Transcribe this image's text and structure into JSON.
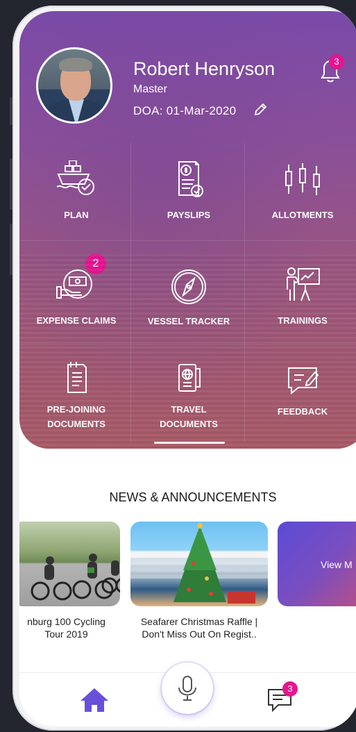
{
  "profile": {
    "name": "Robert Henryson",
    "rank": "Master",
    "doa": "DOA:  01-Mar-2020",
    "notification_count": "3"
  },
  "menu": [
    {
      "label_1": "PLAN",
      "label_2": "",
      "icon": "ship-check-icon"
    },
    {
      "label_1": "PAYSLIPS",
      "label_2": "",
      "icon": "payslip-icon"
    },
    {
      "label_1": "ALLOTMENTS",
      "label_2": "",
      "icon": "candlestick-icon"
    },
    {
      "label_1": "EXPENSE CLAIMS",
      "label_2": "",
      "icon": "expense-icon",
      "badge": "2"
    },
    {
      "label_1": "VESSEL TRACKER",
      "label_2": "",
      "icon": "compass-icon"
    },
    {
      "label_1": "TRAININGS",
      "label_2": "",
      "icon": "trainer-board-icon"
    },
    {
      "label_1": "PRE-JOINING",
      "label_2": "DOCUMENTS",
      "icon": "document-icon"
    },
    {
      "label_1": "TRAVEL",
      "label_2": "DOCUMENTS",
      "icon": "passport-icon"
    },
    {
      "label_1": "FEEDBACK",
      "label_2": "",
      "icon": "feedback-icon"
    }
  ],
  "news": {
    "title": "NEWS & ANNOUNCEMENTS",
    "cards": [
      {
        "caption_1": "nburg 100 Cycling",
        "caption_2": "Tour 2019"
      },
      {
        "caption_1": "Seafarer Christmas Raffle |",
        "caption_2": "Don't Miss Out On Regist.."
      }
    ],
    "view_more": "View M"
  },
  "bottom_nav": {
    "chat_count": "3",
    "icons": [
      "home-icon",
      "microphone-icon",
      "chat-icon"
    ]
  },
  "colors": {
    "badge": "#e6158f",
    "home_active": "#6a4fd8",
    "hero_top": "#7a4aa8",
    "hero_bottom": "#a85a66"
  }
}
